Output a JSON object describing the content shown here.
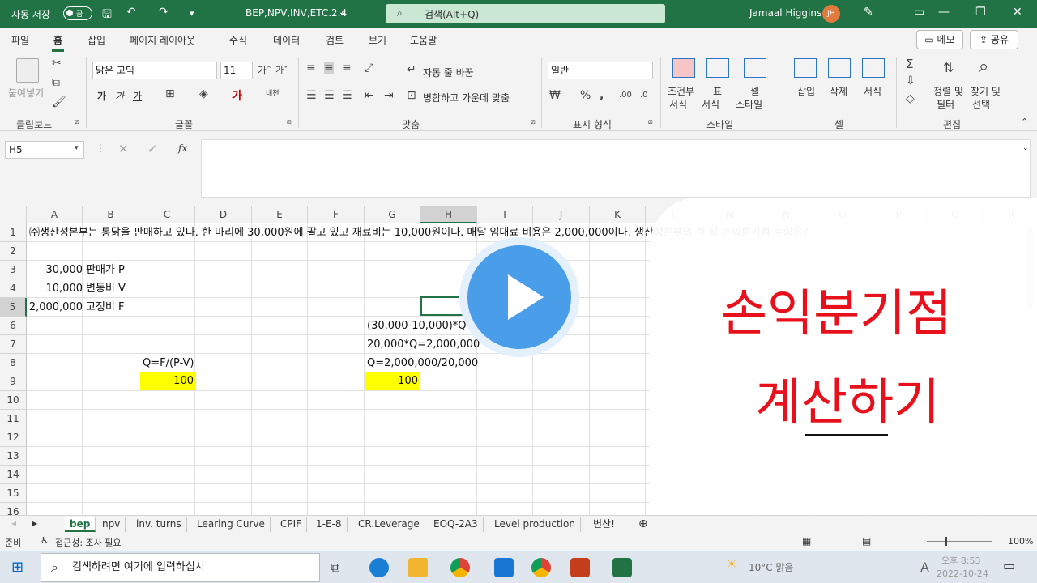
{
  "titlebar": {
    "autosave_label": "자동 저장",
    "autosave_state": "끔",
    "filename": "BEP,NPV,INV,ETC.2.4",
    "search_placeholder": "검색(Alt+Q)",
    "user_name": "Jamaal Higgins",
    "user_initials": "JH"
  },
  "ribbon_tabs": [
    "파일",
    "홈",
    "삽입",
    "페이지 레이아웃",
    "수식",
    "데이터",
    "검토",
    "보기",
    "도움말"
  ],
  "ribbon_actions": {
    "memo": "메모",
    "share": "공유"
  },
  "ribbon": {
    "clipboard": {
      "paste": "붙여넣기",
      "label": "클립보드"
    },
    "font": {
      "name": "맑은 고딕",
      "size": "11",
      "bold": "가",
      "italic": "가",
      "underline": "가",
      "phonetic": "내천",
      "label": "글꼴"
    },
    "align": {
      "wrap": "자동 줄 바꿈",
      "merge": "병합하고 가운데 맞춤",
      "label": "맞춤"
    },
    "number": {
      "format": "일반",
      "label": "표시 형식"
    },
    "styles": {
      "conditional": "조건부",
      "conditional2": "서식",
      "table": "표",
      "table2": "서식",
      "cell": "셀",
      "cell2": "스타일",
      "label": "스타일"
    },
    "cells": {
      "insert": "삽입",
      "delete": "삭제",
      "format": "서식",
      "label": "셀"
    },
    "editing": {
      "sort": "정렬 및",
      "sort2": "필터",
      "find": "찾기 및",
      "find2": "선택",
      "label": "편집"
    }
  },
  "formula_bar": {
    "name_box": "H5",
    "fx": "fx",
    "formula": ""
  },
  "columns": [
    "A",
    "B",
    "C",
    "D",
    "E",
    "F",
    "G",
    "H",
    "I",
    "J",
    "K",
    "L",
    "M",
    "N",
    "O",
    "P",
    "Q",
    "R"
  ],
  "rows": [
    "1",
    "2",
    "3",
    "4",
    "5",
    "6",
    "7",
    "8",
    "9",
    "10",
    "11",
    "12",
    "13",
    "14",
    "15",
    "16"
  ],
  "cells": {
    "A1": "㈜생산성본부는 통닭을 판매하고 있다. 한 마리에 30,000원에 팔고 있고 재료비는 10,000원이다. 매달 임대료 비용은 2,000,000이다. 생산성본부의 한 달 손익분기점 수량은?",
    "A3": "30,000",
    "B3": "판매가 P",
    "A4": "10,000",
    "B4": "변동비 V",
    "A5": "2,000,000",
    "B5": "고정비 F",
    "G6": "(30,000-10,000)*Q=2,000,000",
    "G7": "20,000*Q=2,000,000",
    "G8": "Q=2,000,000/20,000",
    "C8": "Q=F/(P-V)",
    "C9": "100",
    "G9": "100"
  },
  "overlay": {
    "line1": "손익분기점",
    "line2": "계산하기",
    "play_icon": "play-icon"
  },
  "sheet_tabs": [
    "bep",
    "npv",
    "inv. turns",
    "Learing Curve",
    "CPIF",
    "1-E-8",
    "CR.Leverage",
    "EOQ-2A3",
    "Level production",
    "변산!"
  ],
  "active_sheet": "bep",
  "statusbar": {
    "ready": "준비",
    "accessibility": "접근성: 조사 필요",
    "zoom": "100%"
  },
  "taskbar": {
    "search_placeholder": "검색하려면 여기에 입력하십시",
    "weather": "10°C 맑음",
    "time": "오후 8:53",
    "date": "2022-10-24"
  },
  "colors": {
    "excel_green": "#217346",
    "highlight": "#ffff00",
    "overlay_text": "#e8111b",
    "play_blue": "#4a9de8"
  }
}
